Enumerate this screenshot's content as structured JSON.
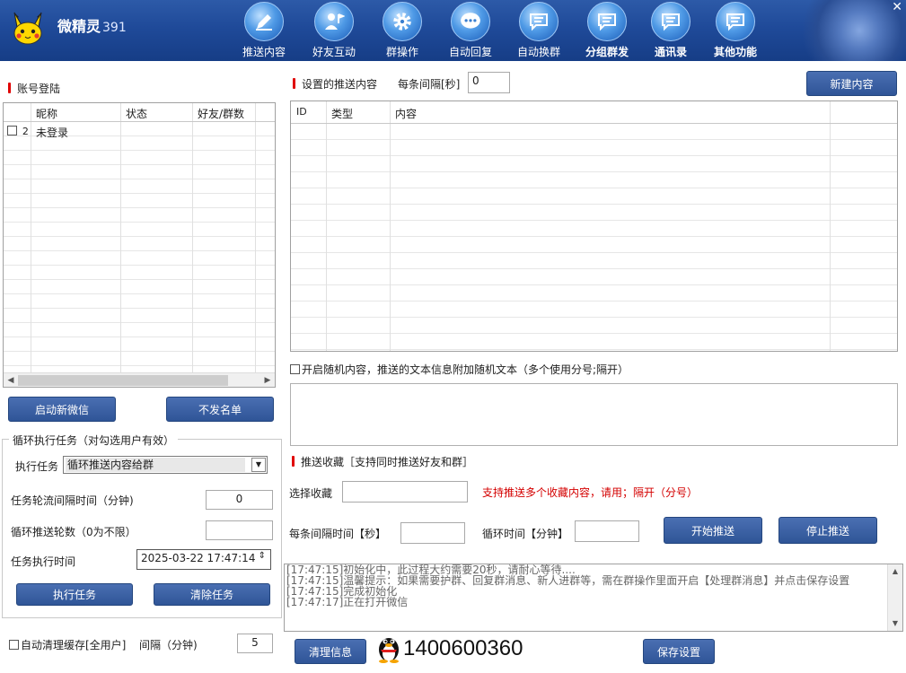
{
  "app": {
    "title": "微精灵",
    "version": "391",
    "close_glyph": "✕"
  },
  "nav": [
    {
      "label": "推送内容",
      "icon": "pen-icon"
    },
    {
      "label": "好友互动",
      "icon": "person-flag-icon"
    },
    {
      "label": "群操作",
      "icon": "gear-icon"
    },
    {
      "label": "自动回复",
      "icon": "chat-dots-icon"
    },
    {
      "label": "自动换群",
      "icon": "chat-lines-icon"
    },
    {
      "label": "分组群发",
      "icon": "chat-lines-icon"
    },
    {
      "label": "通讯录",
      "icon": "chat-lines-icon"
    },
    {
      "label": "其他功能",
      "icon": "chat-lines-icon"
    }
  ],
  "account": {
    "section_label": "账号登陆",
    "columns": [
      "昵称",
      "状态",
      "好友/群数"
    ],
    "rows": [
      {
        "index": "2",
        "nickname": "未登录",
        "status": "",
        "count": ""
      }
    ],
    "start_button": "启动新微信",
    "blacklist_button": "不发名单"
  },
  "loop": {
    "title": "循环执行任务（对勾选用户有效）",
    "task_label": "执行任务",
    "task_value": "循环推送内容给群",
    "interval_label": "任务轮流间隔时间（分钟)",
    "interval_value": "0",
    "rounds_label": "循环推送轮数（0为不限）",
    "rounds_value": "",
    "time_label": "任务执行时间",
    "time_value": "2025-03-22 17:47:14",
    "execute_button": "执行任务",
    "clear_button": "清除任务"
  },
  "cache": {
    "label": "自动清理缓存[全用户]",
    "interval_label": "间隔（分钟)",
    "interval_value": "5"
  },
  "content": {
    "section_label": "设置的推送内容",
    "interval_label": "每条间隔[秒]",
    "interval_value": "0",
    "new_button": "新建内容",
    "columns": [
      "ID",
      "类型",
      "内容"
    ],
    "random_label": "开启随机内容，推送的文本信息附加随机文本（多个使用分号;隔开）"
  },
  "favorites": {
    "section_label": "推送收藏［支持同时推送好友和群］",
    "select_label": "选择收藏",
    "select_value": "",
    "hint": "支持推送多个收藏内容，请用；隔开（分号）",
    "hint_color": "#d40000",
    "interval_label": "每条间隔时间【秒】",
    "interval_value": "",
    "loop_label": "循环时间【分钟】",
    "loop_value": "",
    "start_button": "开始推送",
    "stop_button": "停止推送"
  },
  "log": [
    "[17:47:15]初始化中，此过程大约需要20秒，请耐心等待....",
    "[17:47:15]温馨提示：如果需要护群、回复群消息、新人进群等，需在群操作里面开启【处理群消息】并点击保存设置",
    "[17:47:15]完成初始化",
    "[17:47:17]正在打开微信"
  ],
  "footer": {
    "clear_button": "清理信息",
    "qq_number": "1400600360",
    "save_button": "保存设置"
  }
}
